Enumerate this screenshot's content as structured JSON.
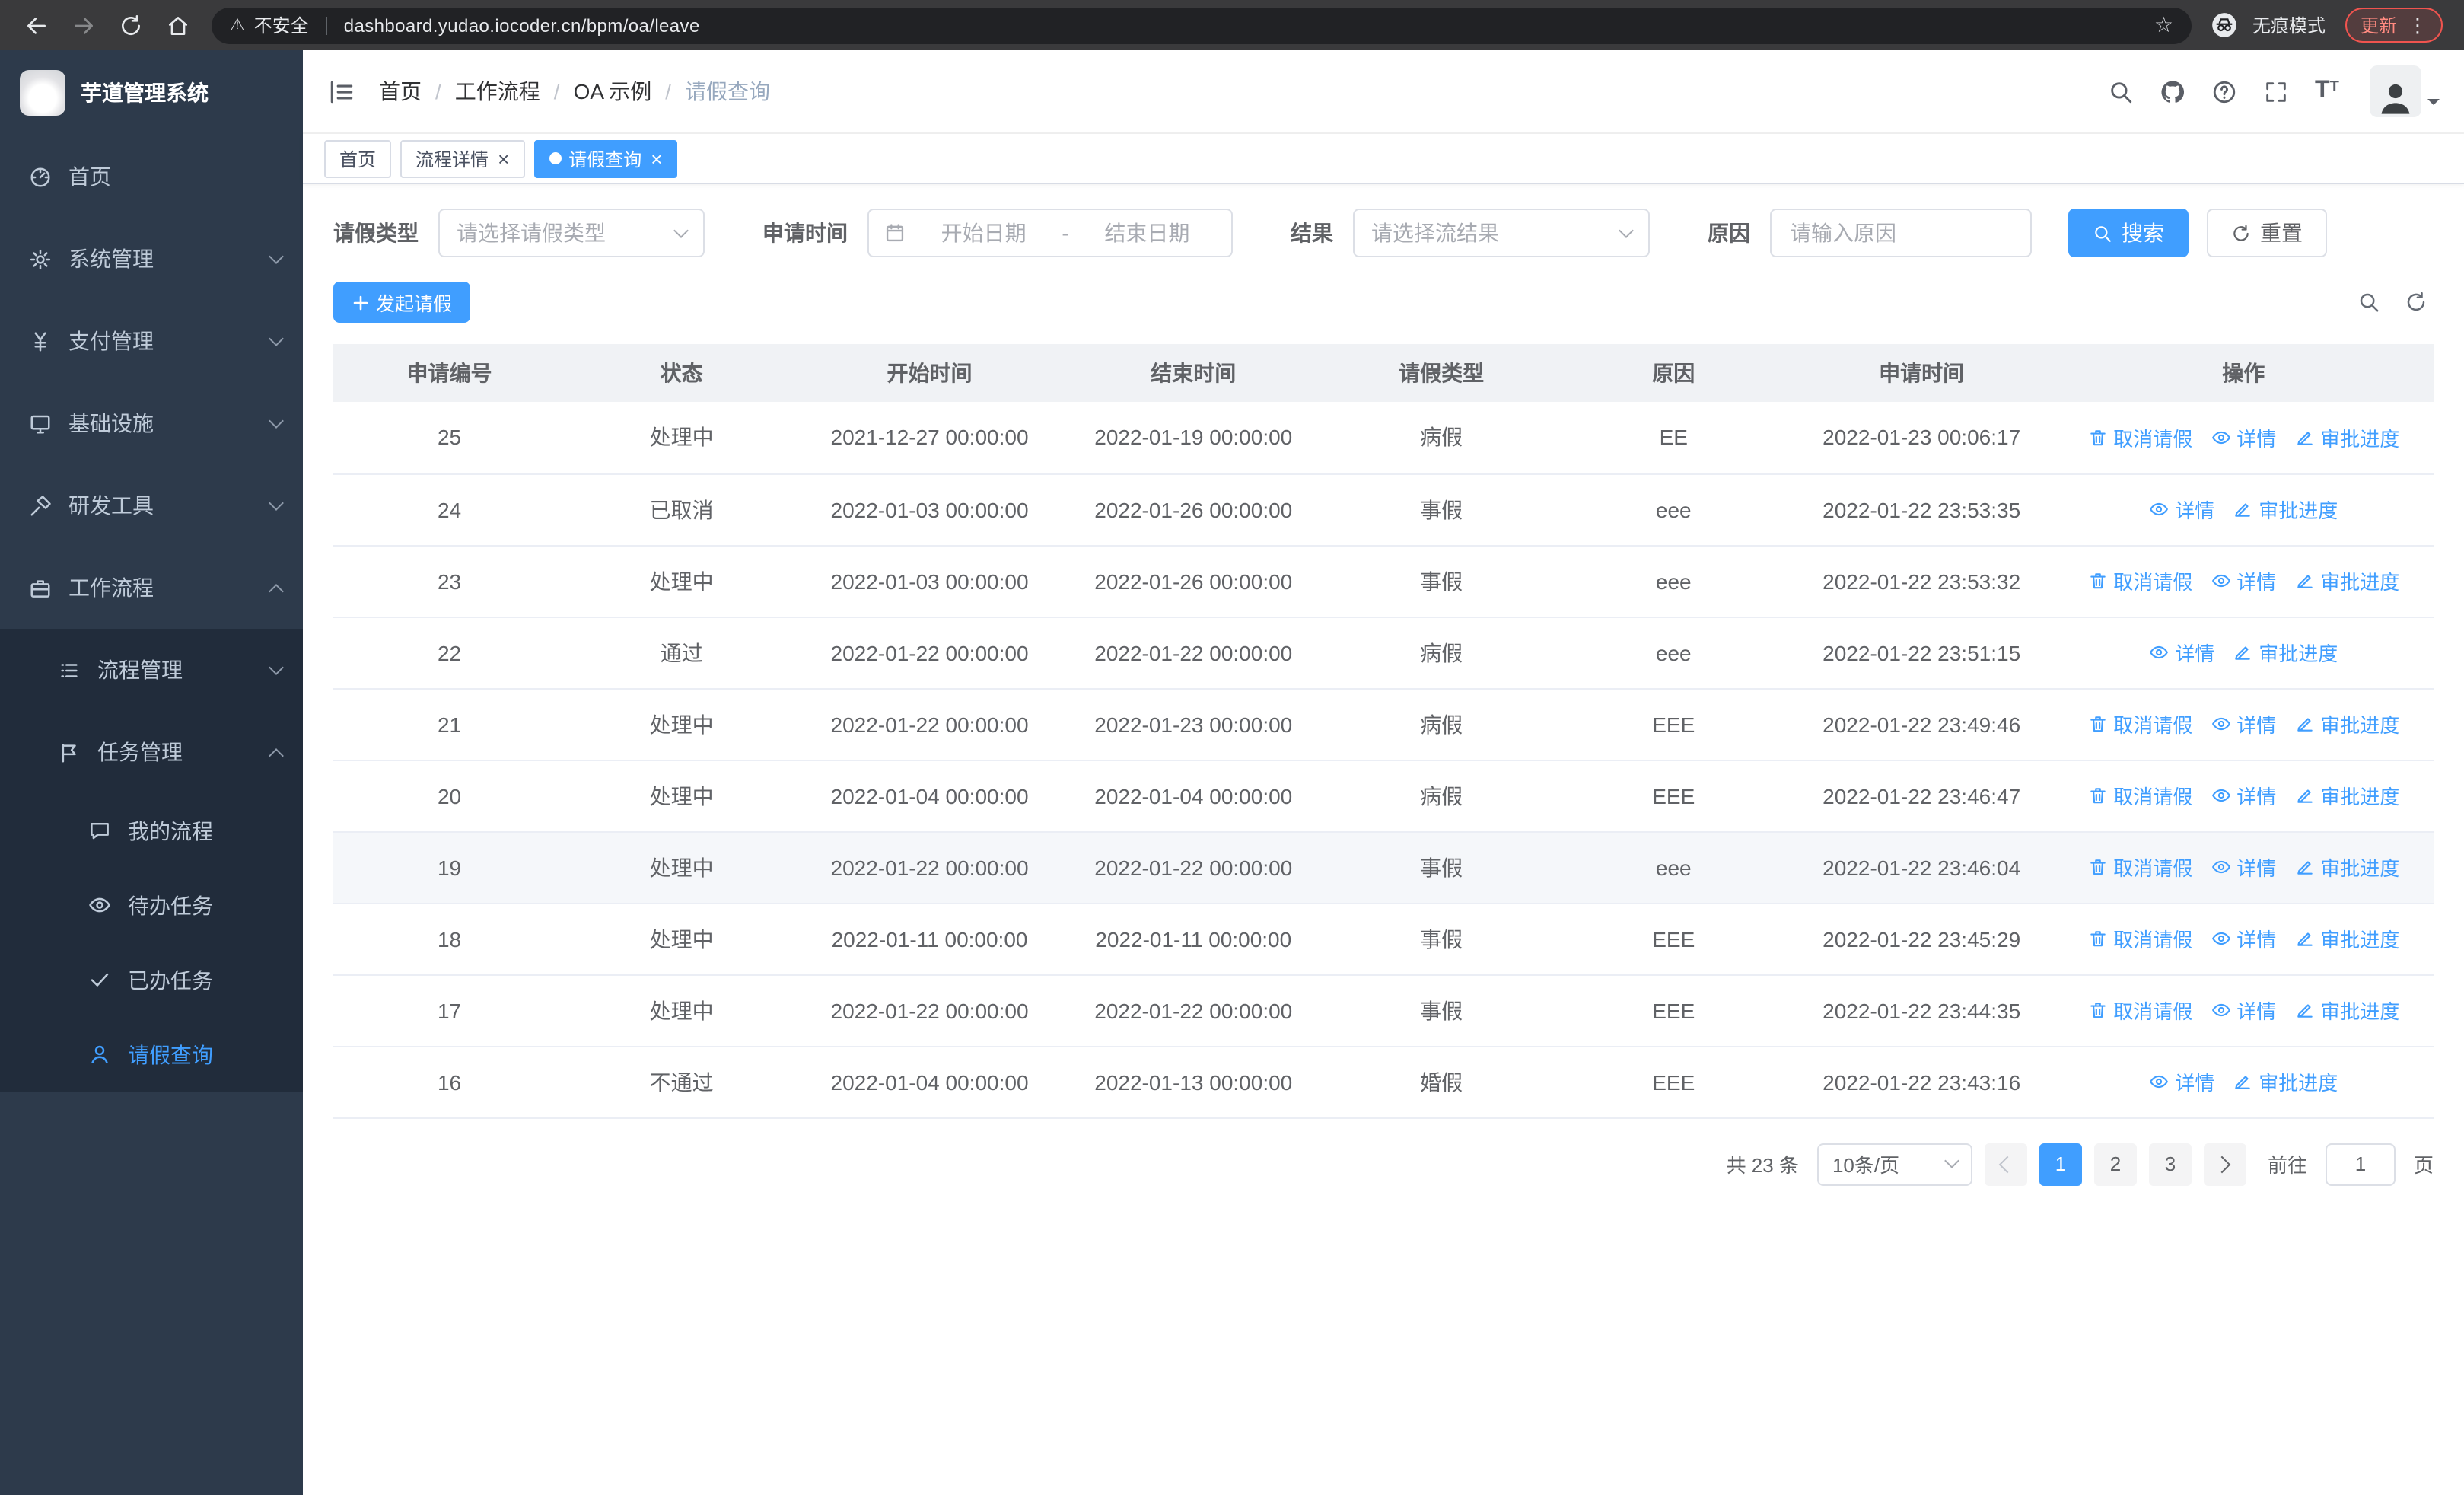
{
  "colors": {
    "accent": "#409eff"
  },
  "browser": {
    "nav_icons": [
      {
        "name": "back-icon",
        "enabled": true
      },
      {
        "name": "forward-icon",
        "enabled": false
      },
      {
        "name": "reload-icon",
        "enabled": true
      },
      {
        "name": "home-icon",
        "enabled": true
      }
    ],
    "security_warning": "不安全",
    "url": "dashboard.yudao.iocoder.cn/bpm/oa/leave",
    "incognito_label": "无痕模式",
    "update_label": "更新"
  },
  "sidebar": {
    "logo_title": "芋道管理系统",
    "items": [
      {
        "key": "home",
        "label": "首页",
        "icon": "dashboard-icon",
        "level": 1
      },
      {
        "key": "system",
        "label": "系统管理",
        "icon": "gear-icon",
        "level": 1,
        "expandable": true,
        "expanded": false
      },
      {
        "key": "payment",
        "label": "支付管理",
        "icon": "yen-icon",
        "level": 1,
        "expandable": true,
        "expanded": false
      },
      {
        "key": "infrastructure",
        "label": "基础设施",
        "icon": "monitor-icon",
        "level": 1,
        "expandable": true,
        "expanded": false
      },
      {
        "key": "dev-tools",
        "label": "研发工具",
        "icon": "hammer-icon",
        "level": 1,
        "expandable": true,
        "expanded": false
      },
      {
        "key": "workflow",
        "label": "工作流程",
        "icon": "briefcase-icon",
        "level": 1,
        "expandable": true,
        "expanded": true
      },
      {
        "key": "process-management",
        "label": "流程管理",
        "icon": "list-icon",
        "level": 2,
        "expandable": true,
        "expanded": false
      },
      {
        "key": "task-management",
        "label": "任务管理",
        "icon": "flag-icon",
        "level": 2,
        "expandable": true,
        "expanded": true
      },
      {
        "key": "my-processes",
        "label": "我的流程",
        "icon": "chat-icon",
        "level": 3
      },
      {
        "key": "todo-tasks",
        "label": "待办任务",
        "icon": "eye-icon",
        "level": 3
      },
      {
        "key": "done-tasks",
        "label": "已办任务",
        "icon": "check-icon",
        "level": 3
      },
      {
        "key": "leave-query",
        "label": "请假查询",
        "icon": "user-icon",
        "level": 3,
        "active": true
      }
    ]
  },
  "header": {
    "breadcrumb": [
      "首页",
      "工作流程",
      "OA 示例",
      "请假查询"
    ],
    "icons": [
      "search-icon",
      "github-icon",
      "question-icon",
      "fullscreen-icon",
      "font-size-icon"
    ]
  },
  "tabs": [
    {
      "key": "home",
      "label": "首页",
      "closable": false,
      "active": false
    },
    {
      "key": "process-detail",
      "label": "流程详情",
      "closable": true,
      "active": false
    },
    {
      "key": "leave-query",
      "label": "请假查询",
      "closable": true,
      "active": true
    }
  ],
  "filters": {
    "leave_type_label": "请假类型",
    "leave_type_placeholder": "请选择请假类型",
    "apply_time_label": "申请时间",
    "start_date_placeholder": "开始日期",
    "range_separator": "-",
    "end_date_placeholder": "结束日期",
    "result_label": "结果",
    "result_placeholder": "请选择流结果",
    "reason_label": "原因",
    "reason_placeholder": "请输入原因",
    "search_label": "搜索",
    "reset_label": "重置"
  },
  "toolbar": {
    "create_label": "发起请假",
    "icons": [
      "search-icon",
      "refresh-icon"
    ]
  },
  "table": {
    "columns": [
      "申请编号",
      "状态",
      "开始时间",
      "结束时间",
      "请假类型",
      "原因",
      "申请时间",
      "操作"
    ],
    "action_defs": {
      "cancel": {
        "label": "取消请假",
        "icon": "trash-icon"
      },
      "detail": {
        "label": "详情",
        "icon": "eye-icon"
      },
      "progress": {
        "label": "审批进度",
        "icon": "edit-icon"
      }
    },
    "rows": [
      {
        "id": "25",
        "status": "处理中",
        "start_time": "2021-12-27 00:00:00",
        "end_time": "2022-01-19 00:00:00",
        "leave_type": "病假",
        "reason": "EE",
        "apply_time": "2022-01-23 00:06:17",
        "actions": [
          "cancel",
          "detail",
          "progress"
        ]
      },
      {
        "id": "24",
        "status": "已取消",
        "start_time": "2022-01-03 00:00:00",
        "end_time": "2022-01-26 00:00:00",
        "leave_type": "事假",
        "reason": "eee",
        "apply_time": "2022-01-22 23:53:35",
        "actions": [
          "detail",
          "progress"
        ]
      },
      {
        "id": "23",
        "status": "处理中",
        "start_time": "2022-01-03 00:00:00",
        "end_time": "2022-01-26 00:00:00",
        "leave_type": "事假",
        "reason": "eee",
        "apply_time": "2022-01-22 23:53:32",
        "actions": [
          "cancel",
          "detail",
          "progress"
        ]
      },
      {
        "id": "22",
        "status": "通过",
        "start_time": "2022-01-22 00:00:00",
        "end_time": "2022-01-22 00:00:00",
        "leave_type": "病假",
        "reason": "eee",
        "apply_time": "2022-01-22 23:51:15",
        "actions": [
          "detail",
          "progress"
        ]
      },
      {
        "id": "21",
        "status": "处理中",
        "start_time": "2022-01-22 00:00:00",
        "end_time": "2022-01-23 00:00:00",
        "leave_type": "病假",
        "reason": "EEE",
        "apply_time": "2022-01-22 23:49:46",
        "actions": [
          "cancel",
          "detail",
          "progress"
        ]
      },
      {
        "id": "20",
        "status": "处理中",
        "start_time": "2022-01-04 00:00:00",
        "end_time": "2022-01-04 00:00:00",
        "leave_type": "病假",
        "reason": "EEE",
        "apply_time": "2022-01-22 23:46:47",
        "actions": [
          "cancel",
          "detail",
          "progress"
        ]
      },
      {
        "id": "19",
        "status": "处理中",
        "start_time": "2022-01-22 00:00:00",
        "end_time": "2022-01-22 00:00:00",
        "leave_type": "事假",
        "reason": "eee",
        "apply_time": "2022-01-22 23:46:04",
        "actions": [
          "cancel",
          "detail",
          "progress"
        ],
        "highlighted": true
      },
      {
        "id": "18",
        "status": "处理中",
        "start_time": "2022-01-11 00:00:00",
        "end_time": "2022-01-11 00:00:00",
        "leave_type": "事假",
        "reason": "EEE",
        "apply_time": "2022-01-22 23:45:29",
        "actions": [
          "cancel",
          "detail",
          "progress"
        ]
      },
      {
        "id": "17",
        "status": "处理中",
        "start_time": "2022-01-22 00:00:00",
        "end_time": "2022-01-22 00:00:00",
        "leave_type": "事假",
        "reason": "EEE",
        "apply_time": "2022-01-22 23:44:35",
        "actions": [
          "cancel",
          "detail",
          "progress"
        ]
      },
      {
        "id": "16",
        "status": "不通过",
        "start_time": "2022-01-04 00:00:00",
        "end_time": "2022-01-13 00:00:00",
        "leave_type": "婚假",
        "reason": "EEE",
        "apply_time": "2022-01-22 23:43:16",
        "actions": [
          "detail",
          "progress"
        ]
      }
    ]
  },
  "pagination": {
    "total_text": "共 23 条",
    "page_size_text": "10条/页",
    "pages": [
      "1",
      "2",
      "3"
    ],
    "active_page": "1",
    "goto_label": "前往",
    "goto_value": "1",
    "page_unit": "页"
  }
}
